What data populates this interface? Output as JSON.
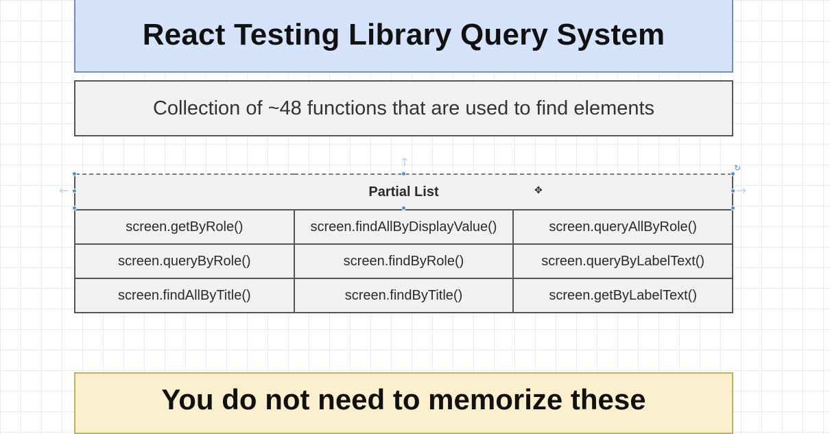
{
  "title": "React Testing Library Query System",
  "subtitle": "Collection of ~48 functions that are used to find elements",
  "table": {
    "header": "Partial List",
    "rows": [
      [
        "screen.getByRole()",
        "screen.findAllByDisplayValue()",
        "screen.queryAllByRole()"
      ],
      [
        "screen.queryByRole()",
        "screen.findByRole()",
        "screen.queryByLabelText()"
      ],
      [
        "screen.findAllByTitle()",
        "screen.findByTitle()",
        "screen.getByLabelText()"
      ]
    ]
  },
  "note": "You do not need to memorize these",
  "icons": {
    "move": "move-cursor-icon",
    "rotate": "rotate-handle-icon",
    "resize": "resize-arrow-icon"
  },
  "colors": {
    "title_fill": "#d6e4fb",
    "title_border": "#6f8ebe",
    "box_fill": "#f1f1f1",
    "box_border": "#555555",
    "note_fill": "#fbf0cd",
    "note_border": "#c9ad55",
    "selection": "#4a90e2"
  }
}
